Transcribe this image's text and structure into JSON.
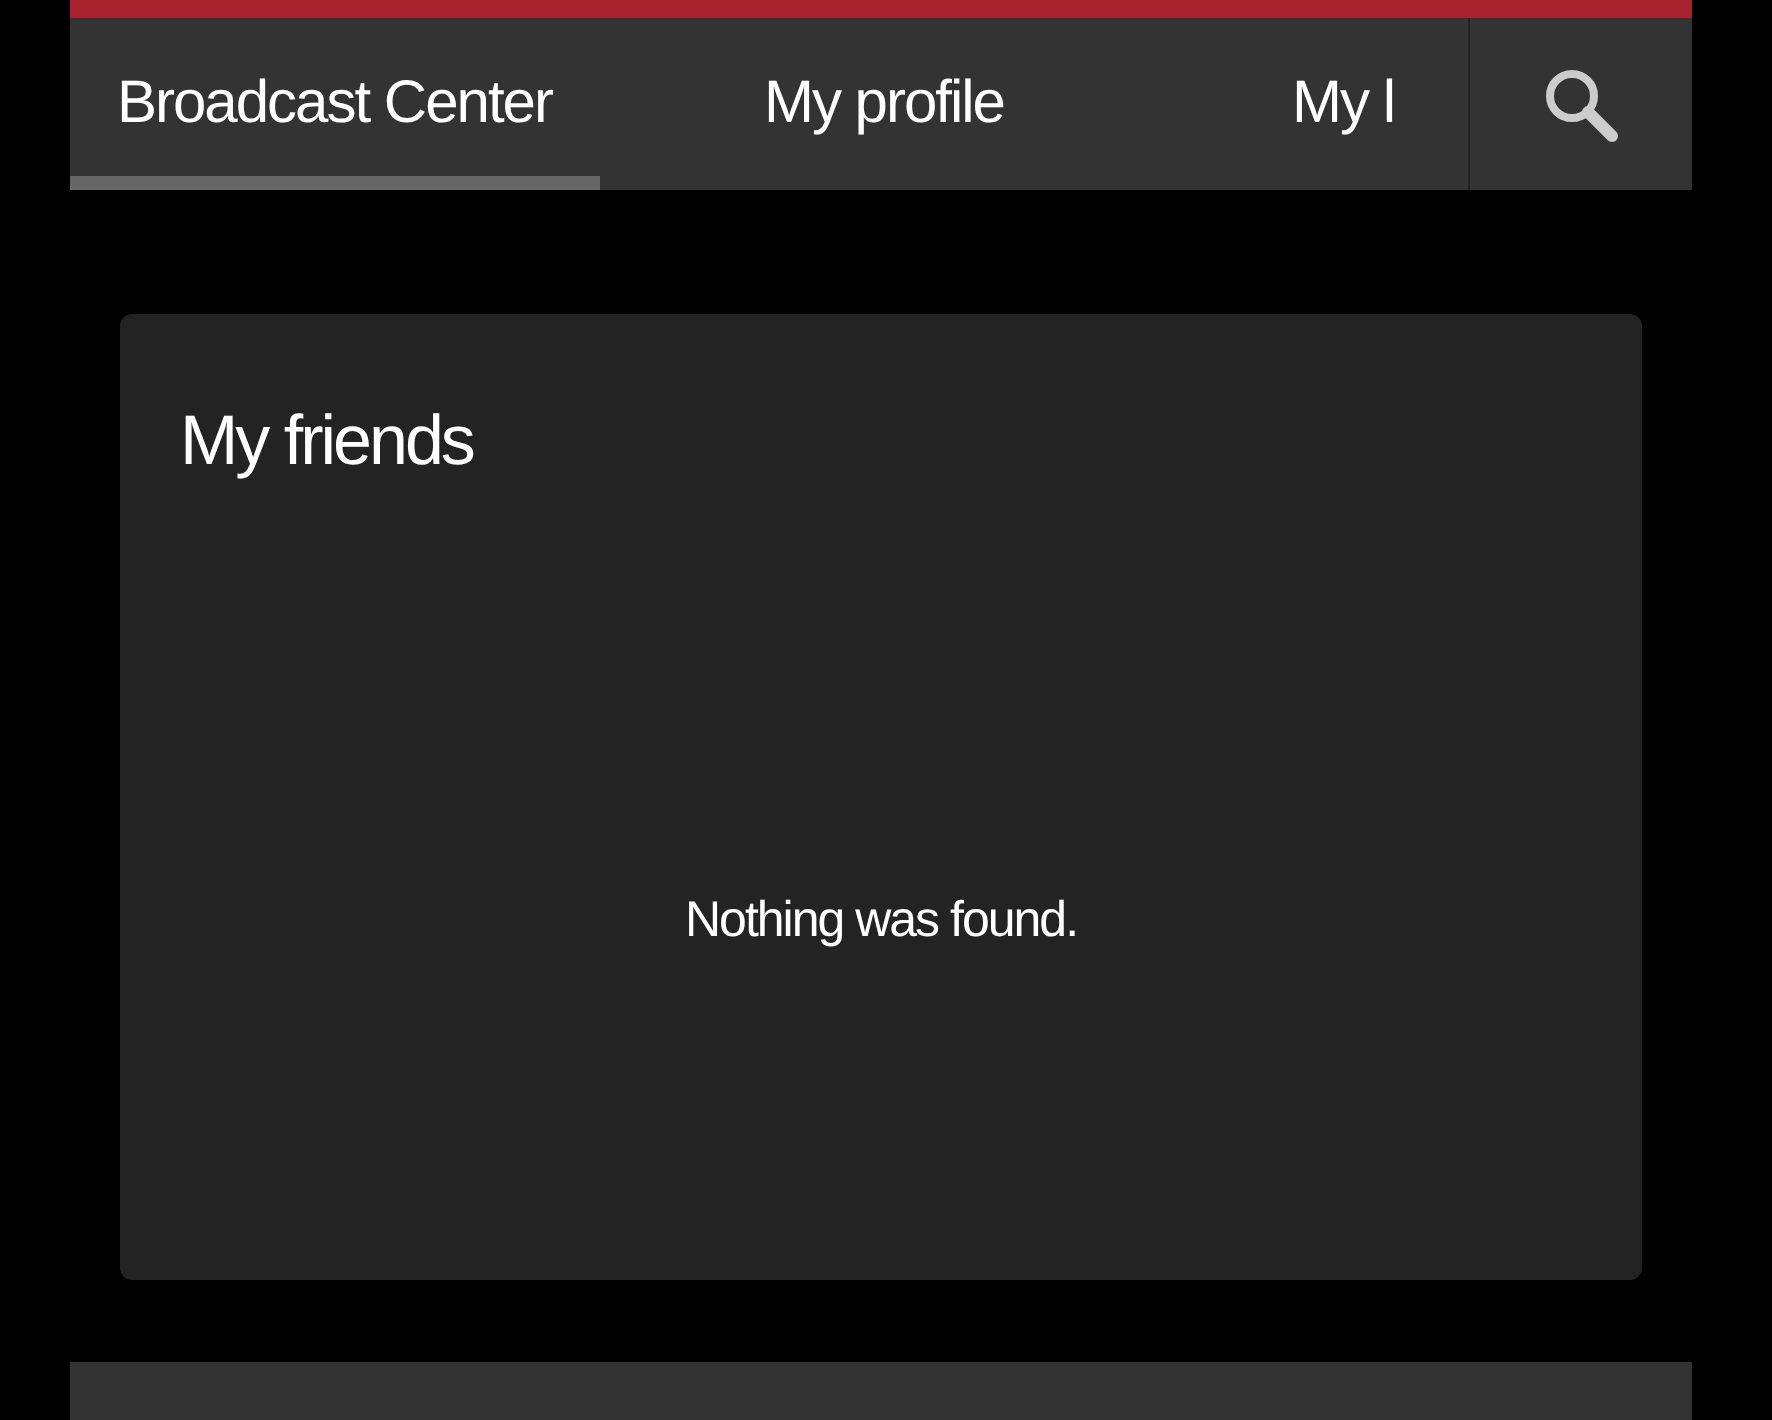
{
  "tabs": [
    {
      "label": "Broadcast Center",
      "selected": true
    },
    {
      "label": "My profile",
      "selected": false
    },
    {
      "label": "My l",
      "selected": false
    }
  ],
  "card": {
    "title": "My friends",
    "empty_message": "Nothing was found."
  }
}
